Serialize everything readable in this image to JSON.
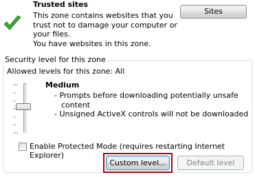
{
  "zone": {
    "name": "Trusted sites",
    "description_lines": [
      "This zone contains websites that you",
      "trust not to damage your computer or",
      "your files.",
      "You have websites in this zone."
    ],
    "icon": "green-check-icon",
    "sites_button": "Sites"
  },
  "security": {
    "group_title": "Security level for this zone",
    "allowed": "Allowed levels for this zone: All",
    "level": {
      "name": "Medium",
      "lines": [
        "- Prompts before downloading potentially unsafe",
        "content",
        "- Unsigned ActiveX controls will not be downloaded"
      ]
    },
    "protected_mode": {
      "label": "Enable Protected Mode (requires restarting Internet Explorer)",
      "checked": false
    },
    "custom_level_button": "Custom level...",
    "default_level_button": "Default level"
  },
  "colors": {
    "check_green": "#3aa935",
    "highlight_border": "#b00000"
  }
}
